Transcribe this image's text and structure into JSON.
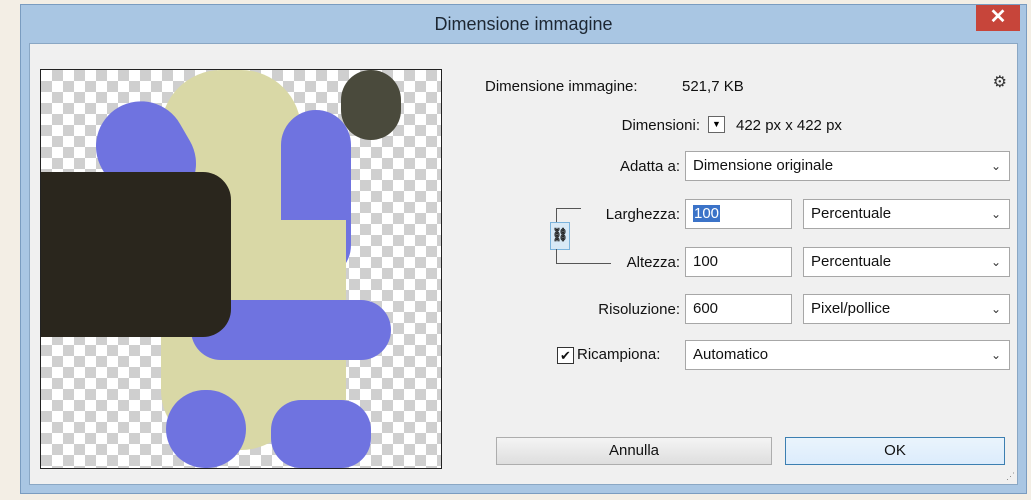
{
  "window": {
    "title": "Dimensione immagine",
    "close_label": "✕"
  },
  "info": {
    "size_label": "Dimensione immagine:",
    "size_value": "521,7 KB",
    "dims_label": "Dimensioni:",
    "dims_value": "422 px x 422 px"
  },
  "fit": {
    "label": "Adatta a:",
    "value": "Dimensione originale"
  },
  "width": {
    "label": "Larghezza:",
    "value": "100",
    "unit": "Percentuale"
  },
  "height": {
    "label": "Altezza:",
    "value": "100",
    "unit": "Percentuale"
  },
  "resolution": {
    "label": "Risoluzione:",
    "value": "600",
    "unit": "Pixel/pollice"
  },
  "resample": {
    "checkbox_label": "Ricampiona:",
    "checked_glyph": "✔",
    "value": "Automatico"
  },
  "buttons": {
    "cancel": "Annulla",
    "ok": "OK"
  },
  "icons": {
    "gear": "⚙",
    "chain": "⛓",
    "dropdown_arrow": "⌄",
    "small_arrow": "▼",
    "resize_grip": "⋰"
  },
  "colors": {
    "titlebar": "#a9c6e3",
    "close": "#c7453a",
    "selection": "#3b73c8"
  }
}
